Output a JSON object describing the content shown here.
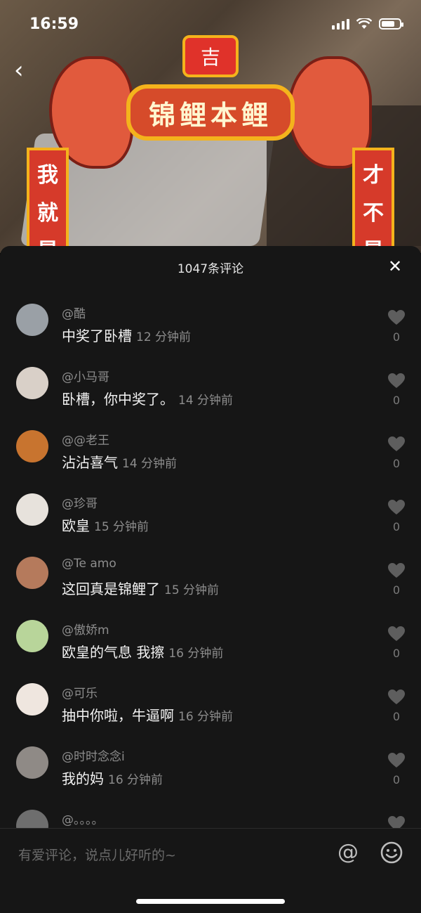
{
  "status": {
    "time": "16:59",
    "battery_level": 0.75
  },
  "video": {
    "banner_text": "锦鲤本鲤",
    "top_char": "吉",
    "left_couplet": [
      "我",
      "就",
      "是"
    ],
    "right_couplet": [
      "才",
      "不",
      "是"
    ]
  },
  "sheet": {
    "title": "1047条评论",
    "close_icon": "close-icon"
  },
  "comments": [
    {
      "user": "@酷",
      "text": "中奖了卧槽",
      "time": "12 分钟前",
      "likes": "0",
      "avatar_color": "#9aa0a6"
    },
    {
      "user": "@小马哥",
      "text": "卧槽，你中奖了。",
      "time": "14 分钟前",
      "likes": "0",
      "avatar_color": "#d9d0c8"
    },
    {
      "user": "@@老王",
      "text": "沾沾喜气",
      "time": "14 分钟前",
      "likes": "0",
      "avatar_color": "#c8742f"
    },
    {
      "user": "@珍哥",
      "text": "欧皇",
      "time": "15 分钟前",
      "likes": "0",
      "avatar_color": "#e7e2dc"
    },
    {
      "user": "@Te amo",
      "text": "这回真是锦鲤了",
      "time": "15 分钟前",
      "likes": "0",
      "avatar_color": "#b57a5c"
    },
    {
      "user": "@傲娇m",
      "text": "欧皇的气息 我擦",
      "time": "16 分钟前",
      "likes": "0",
      "avatar_color": "#b8d59a"
    },
    {
      "user": "@可乐",
      "text": "抽中你啦，牛逼啊",
      "time": "16 分钟前",
      "likes": "0",
      "avatar_color": "#efe6df"
    },
    {
      "user": "@时时念念i",
      "text": "我的妈",
      "time": "16 分钟前",
      "likes": "0",
      "avatar_color": "#8f8a86"
    },
    {
      "user": "@。。。。",
      "text": "",
      "time": "",
      "likes": "",
      "avatar_color": "#6e6e6e"
    }
  ],
  "footer": {
    "placeholder": "有爱评论，说点儿好听的~",
    "at_symbol": "@",
    "emoji_icon": "emoji-icon"
  }
}
